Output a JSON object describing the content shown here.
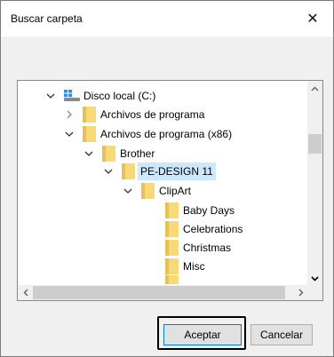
{
  "window": {
    "title": "Buscar carpeta",
    "close_glyph": "✕"
  },
  "tree": {
    "items": [
      {
        "label": "Disco local (C:)",
        "icon": "drive-icon",
        "expander": "expanded",
        "level": 0
      },
      {
        "label": "Archivos de programa",
        "icon": "folder-icon",
        "expander": "collapsed",
        "level": 1
      },
      {
        "label": "Archivos de programa (x86)",
        "icon": "folder-icon",
        "expander": "expanded",
        "level": 1
      },
      {
        "label": "Brother",
        "icon": "folder-icon",
        "expander": "expanded",
        "level": 2
      },
      {
        "label": "PE-DESIGN 11",
        "icon": "folder-icon",
        "expander": "expanded",
        "level": 3,
        "selected": true
      },
      {
        "label": "ClipArt",
        "icon": "folder-icon",
        "expander": "expanded",
        "level": 4
      },
      {
        "label": "Baby Days",
        "icon": "folder-icon",
        "expander": "none",
        "level": 5
      },
      {
        "label": "Celebrations",
        "icon": "folder-icon",
        "expander": "none",
        "level": 5
      },
      {
        "label": "Christmas",
        "icon": "folder-icon",
        "expander": "none",
        "level": 5
      },
      {
        "label": "Misc",
        "icon": "folder-icon",
        "expander": "none",
        "level": 5
      }
    ]
  },
  "buttons": {
    "ok": "Aceptar",
    "cancel": "Cancelar"
  },
  "colors": {
    "selection": "#cce8ff",
    "folder": "#f7d97a",
    "focus": "#000000"
  }
}
